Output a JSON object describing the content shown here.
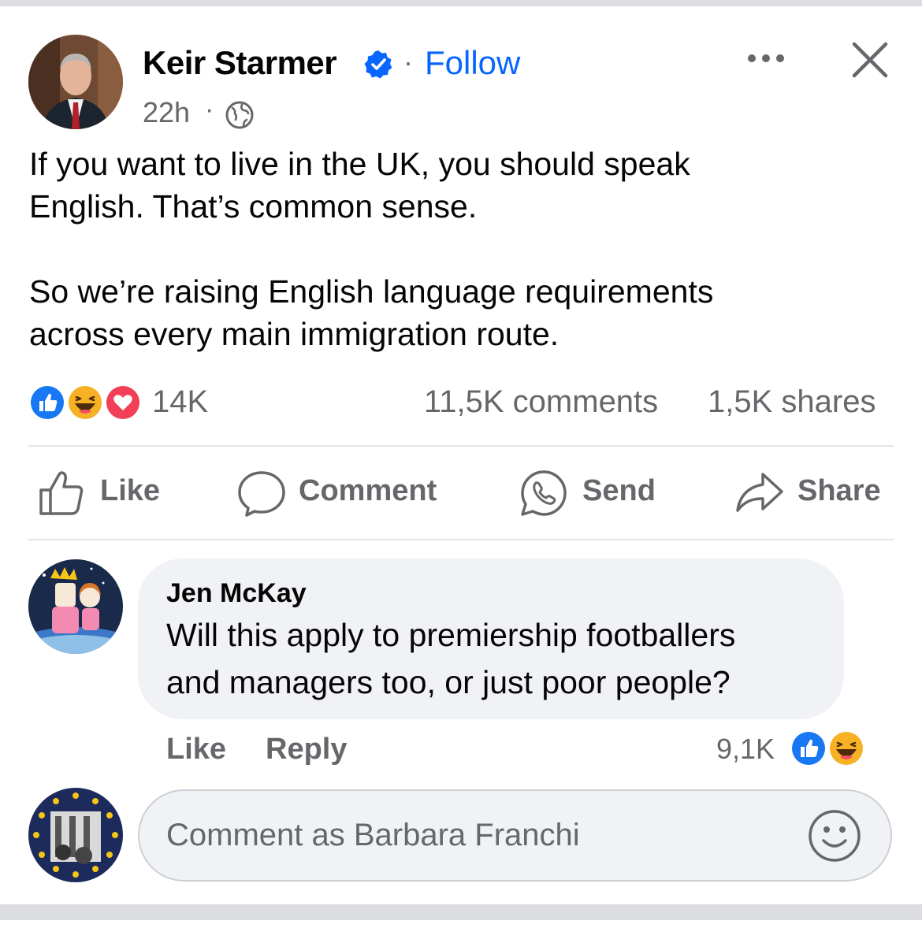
{
  "post": {
    "author": "Keir Starmer",
    "follow_label": "Follow",
    "separator": "·",
    "time": "22h",
    "meta_separator": "·",
    "text_lines_1": [
      "If you want to live in the UK, you should speak",
      "English. That’s common sense."
    ],
    "text_lines_2": [
      "So we’re raising English language requirements",
      "across every main immigration route."
    ],
    "reactions": [
      "like",
      "haha",
      "love"
    ],
    "reaction_count": "14K",
    "comments_count": "11,5K comments",
    "shares_count": "1,5K shares"
  },
  "actions": {
    "like": "Like",
    "comment": "Comment",
    "send": "Send",
    "share": "Share"
  },
  "comment": {
    "author": "Jen McKay",
    "text_lines": [
      "Will this apply to premiership footballers",
      "and managers too, or just poor people?"
    ],
    "like_label": "Like",
    "reply_label": "Reply",
    "reaction_count": "9,1K",
    "reactions": [
      "like",
      "haha"
    ]
  },
  "composer": {
    "placeholder": "Comment as Barbara Franchi"
  },
  "icons": {
    "verified": "verified-badge-icon",
    "privacy": "globe-icon",
    "more": "more-options-icon",
    "close": "close-icon",
    "like": "thumbs-up-icon",
    "comment": "speech-bubble-icon",
    "send": "whatsapp-icon",
    "share": "share-arrow-icon",
    "emoji": "smiley-icon"
  },
  "colors": {
    "accent": "#0866ff",
    "secondary_text": "#65676b",
    "love": "#f33e58",
    "haha": "#f7b125"
  }
}
